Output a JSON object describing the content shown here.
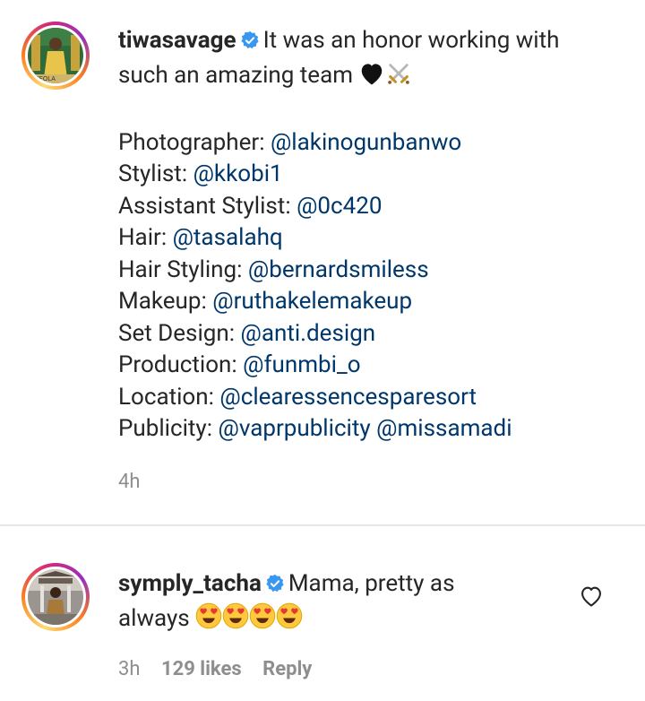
{
  "post": {
    "username": "tiwasavage",
    "caption_line1": "It was an honor working with",
    "caption_line2": "such an amazing team",
    "credits": [
      {
        "role": "Photographer:",
        "handles": [
          "@lakinogunbanwo"
        ]
      },
      {
        "role": "Stylist:",
        "handles": [
          "@kkobi1"
        ]
      },
      {
        "role": "Assistant Stylist:",
        "handles": [
          "@0c420"
        ]
      },
      {
        "role": "Hair:",
        "handles": [
          "@tasalahq"
        ]
      },
      {
        "role": "Hair Styling:",
        "handles": [
          "@bernardsmiless"
        ]
      },
      {
        "role": "Makeup:",
        "handles": [
          "@ruthakelemakeup"
        ]
      },
      {
        "role": "Set Design:",
        "handles": [
          "@anti.design"
        ]
      },
      {
        "role": "Production:",
        "handles": [
          "@funmbi_o"
        ]
      },
      {
        "role": "Location:",
        "handles": [
          "@clearessencesparesort"
        ]
      },
      {
        "role": "Publicity:",
        "handles": [
          "@vaprpublicity",
          "@missamadi"
        ]
      }
    ],
    "time": "4h"
  },
  "comment": {
    "username": "symply_tacha",
    "text_line1": "Mama, pretty as",
    "text_line2": "always",
    "time": "3h",
    "likes": "129 likes",
    "reply_label": "Reply"
  },
  "icons": {
    "verified": "verified-badge-icon",
    "black_heart": "black-heart-icon",
    "swords": "crossed-swords-icon",
    "heart_eyes": "heart-eyes-emoji",
    "like": "heart-outline-icon"
  },
  "colors": {
    "text": "#262626",
    "mention": "#00376b",
    "muted": "#8e8e8e",
    "verified": "#3897f0"
  }
}
